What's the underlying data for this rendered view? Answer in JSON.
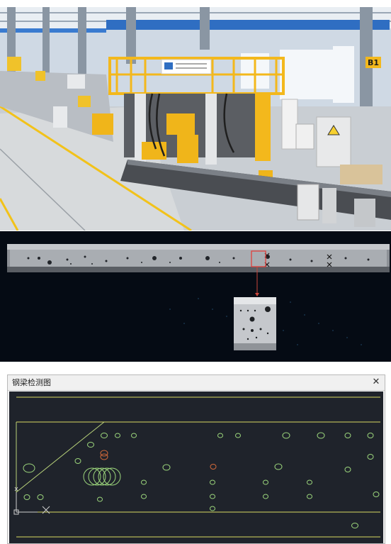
{
  "cad_window": {
    "title": "钢梁检测图",
    "close_icon": "close-icon",
    "colors": {
      "background": "#1f232b",
      "beam_lines": "#d8d860",
      "holes": "#9cd67c",
      "defect_holes": "#d46a3a",
      "axis": "#cfcfcf"
    }
  },
  "scan_panel": {
    "marker_color": "#e53935",
    "background": "#050b14"
  },
  "photo_panel": {
    "sign_text": "B1"
  }
}
